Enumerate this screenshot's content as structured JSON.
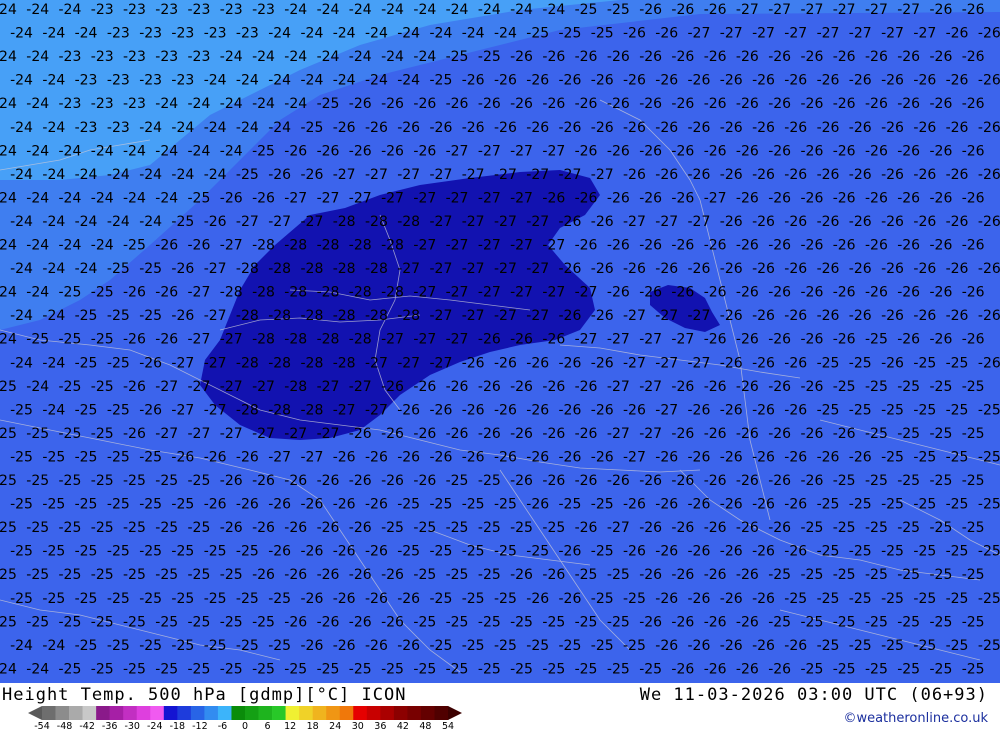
{
  "map": {
    "label_rows": [
      {
        "labels": [
          "24",
          "24",
          "24",
          "23",
          "23",
          "23",
          "23",
          "23",
          "23",
          "24",
          "24",
          "24",
          "24",
          "24",
          "24",
          "24",
          "24",
          "24",
          "25",
          "25",
          "26",
          "26",
          "26",
          "27",
          "27",
          "27",
          "27",
          "27",
          "27",
          "26",
          "26"
        ]
      },
      {
        "labels": [
          "24",
          "24",
          "24",
          "23",
          "23",
          "23",
          "23",
          "23",
          "24",
          "24",
          "24",
          "24",
          "24",
          "24",
          "24",
          "24",
          "25",
          "25",
          "25",
          "26",
          "26",
          "27",
          "27",
          "27",
          "27",
          "27",
          "27",
          "27",
          "27",
          "26",
          "26"
        ]
      },
      {
        "labels": [
          "24",
          "24",
          "23",
          "23",
          "23",
          "23",
          "23",
          "24",
          "24",
          "24",
          "24",
          "24",
          "24",
          "24",
          "25",
          "25",
          "26",
          "26",
          "26",
          "26",
          "26",
          "26",
          "26",
          "26",
          "26",
          "26",
          "26",
          "26",
          "26",
          "26",
          "26"
        ]
      },
      {
        "labels": [
          "24",
          "24",
          "23",
          "23",
          "23",
          "23",
          "24",
          "24",
          "24",
          "24",
          "24",
          "24",
          "24",
          "25",
          "26",
          "26",
          "26",
          "26",
          "26",
          "26",
          "26",
          "26",
          "26",
          "26",
          "26",
          "26",
          "26",
          "26",
          "26",
          "26",
          "26"
        ]
      },
      {
        "labels": [
          "24",
          "24",
          "23",
          "23",
          "23",
          "24",
          "24",
          "24",
          "24",
          "24",
          "25",
          "26",
          "26",
          "26",
          "26",
          "26",
          "26",
          "26",
          "26",
          "26",
          "26",
          "26",
          "26",
          "26",
          "26",
          "26",
          "26",
          "26",
          "26",
          "26",
          "26"
        ]
      },
      {
        "labels": [
          "24",
          "24",
          "23",
          "23",
          "24",
          "24",
          "24",
          "24",
          "24",
          "25",
          "26",
          "26",
          "26",
          "26",
          "26",
          "26",
          "26",
          "26",
          "26",
          "26",
          "26",
          "26",
          "26",
          "26",
          "26",
          "26",
          "26",
          "26",
          "26",
          "26",
          "26"
        ]
      },
      {
        "labels": [
          "24",
          "24",
          "24",
          "24",
          "24",
          "24",
          "24",
          "24",
          "25",
          "26",
          "26",
          "26",
          "26",
          "26",
          "27",
          "27",
          "27",
          "27",
          "26",
          "26",
          "26",
          "26",
          "26",
          "26",
          "26",
          "26",
          "26",
          "26",
          "26",
          "26",
          "26"
        ]
      },
      {
        "labels": [
          "24",
          "24",
          "24",
          "24",
          "24",
          "24",
          "24",
          "25",
          "26",
          "26",
          "27",
          "27",
          "27",
          "27",
          "27",
          "27",
          "27",
          "27",
          "27",
          "26",
          "26",
          "26",
          "26",
          "26",
          "26",
          "26",
          "26",
          "26",
          "26",
          "26",
          "26"
        ]
      },
      {
        "labels": [
          "24",
          "24",
          "24",
          "24",
          "24",
          "24",
          "25",
          "26",
          "26",
          "27",
          "27",
          "27",
          "27",
          "27",
          "27",
          "27",
          "27",
          "26",
          "26",
          "26",
          "26",
          "26",
          "27",
          "26",
          "26",
          "26",
          "26",
          "26",
          "26",
          "26",
          "26"
        ]
      },
      {
        "labels": [
          "24",
          "24",
          "24",
          "24",
          "24",
          "25",
          "26",
          "27",
          "27",
          "27",
          "28",
          "28",
          "28",
          "27",
          "27",
          "27",
          "27",
          "26",
          "26",
          "27",
          "27",
          "27",
          "26",
          "26",
          "26",
          "26",
          "26",
          "26",
          "26",
          "26",
          "26"
        ]
      },
      {
        "labels": [
          "24",
          "24",
          "24",
          "24",
          "25",
          "26",
          "26",
          "27",
          "28",
          "28",
          "28",
          "28",
          "28",
          "27",
          "27",
          "27",
          "27",
          "27",
          "26",
          "26",
          "26",
          "26",
          "26",
          "26",
          "26",
          "26",
          "26",
          "26",
          "26",
          "26",
          "26"
        ]
      },
      {
        "labels": [
          "24",
          "24",
          "24",
          "25",
          "25",
          "26",
          "27",
          "28",
          "28",
          "28",
          "28",
          "28",
          "27",
          "27",
          "27",
          "27",
          "27",
          "26",
          "26",
          "26",
          "26",
          "26",
          "26",
          "26",
          "26",
          "26",
          "26",
          "26",
          "26",
          "26",
          "26"
        ]
      },
      {
        "labels": [
          "24",
          "24",
          "25",
          "25",
          "26",
          "26",
          "27",
          "28",
          "28",
          "28",
          "28",
          "28",
          "28",
          "27",
          "27",
          "27",
          "27",
          "27",
          "27",
          "26",
          "26",
          "26",
          "26",
          "26",
          "26",
          "26",
          "26",
          "26",
          "26",
          "26",
          "26"
        ]
      },
      {
        "labels": [
          "24",
          "24",
          "25",
          "25",
          "25",
          "26",
          "27",
          "28",
          "28",
          "28",
          "28",
          "28",
          "28",
          "27",
          "27",
          "27",
          "27",
          "26",
          "26",
          "27",
          "27",
          "27",
          "26",
          "26",
          "26",
          "26",
          "26",
          "26",
          "26",
          "26",
          "26"
        ]
      },
      {
        "labels": [
          "24",
          "25",
          "25",
          "25",
          "26",
          "26",
          "27",
          "27",
          "28",
          "28",
          "28",
          "28",
          "27",
          "27",
          "27",
          "26",
          "26",
          "26",
          "27",
          "27",
          "27",
          "27",
          "26",
          "26",
          "26",
          "26",
          "26",
          "25",
          "26",
          "26",
          "26"
        ]
      },
      {
        "labels": [
          "24",
          "24",
          "25",
          "25",
          "26",
          "27",
          "27",
          "28",
          "28",
          "28",
          "28",
          "27",
          "27",
          "27",
          "26",
          "26",
          "26",
          "26",
          "26",
          "27",
          "27",
          "27",
          "26",
          "26",
          "26",
          "25",
          "25",
          "26",
          "25",
          "25",
          "26"
        ]
      },
      {
        "labels": [
          "25",
          "24",
          "25",
          "25",
          "26",
          "27",
          "27",
          "27",
          "27",
          "28",
          "27",
          "27",
          "26",
          "26",
          "26",
          "26",
          "26",
          "26",
          "26",
          "27",
          "27",
          "26",
          "26",
          "26",
          "26",
          "26",
          "25",
          "25",
          "25",
          "25",
          "25"
        ]
      },
      {
        "labels": [
          "25",
          "24",
          "25",
          "25",
          "26",
          "27",
          "27",
          "28",
          "28",
          "28",
          "27",
          "27",
          "26",
          "26",
          "26",
          "26",
          "26",
          "26",
          "26",
          "26",
          "27",
          "26",
          "26",
          "26",
          "26",
          "25",
          "25",
          "25",
          "25",
          "25",
          "25"
        ]
      },
      {
        "labels": [
          "25",
          "25",
          "25",
          "25",
          "26",
          "27",
          "27",
          "27",
          "27",
          "27",
          "27",
          "26",
          "26",
          "26",
          "26",
          "26",
          "26",
          "26",
          "26",
          "27",
          "27",
          "26",
          "26",
          "26",
          "26",
          "26",
          "26",
          "25",
          "25",
          "25",
          "25"
        ]
      },
      {
        "labels": [
          "25",
          "25",
          "25",
          "25",
          "25",
          "26",
          "26",
          "26",
          "27",
          "27",
          "26",
          "26",
          "26",
          "26",
          "26",
          "26",
          "26",
          "26",
          "26",
          "27",
          "26",
          "26",
          "26",
          "26",
          "26",
          "26",
          "26",
          "25",
          "25",
          "25",
          "25"
        ]
      },
      {
        "labels": [
          "25",
          "25",
          "25",
          "25",
          "25",
          "25",
          "25",
          "26",
          "26",
          "26",
          "26",
          "26",
          "26",
          "26",
          "25",
          "25",
          "26",
          "26",
          "26",
          "26",
          "26",
          "26",
          "26",
          "26",
          "26",
          "26",
          "25",
          "25",
          "25",
          "25",
          "25"
        ]
      },
      {
        "labels": [
          "25",
          "25",
          "25",
          "25",
          "25",
          "25",
          "26",
          "26",
          "26",
          "26",
          "26",
          "26",
          "25",
          "25",
          "25",
          "25",
          "26",
          "25",
          "25",
          "26",
          "26",
          "26",
          "26",
          "26",
          "26",
          "25",
          "25",
          "25",
          "25",
          "25",
          "25"
        ]
      },
      {
        "labels": [
          "25",
          "25",
          "25",
          "25",
          "25",
          "25",
          "25",
          "26",
          "26",
          "26",
          "26",
          "26",
          "25",
          "25",
          "25",
          "25",
          "25",
          "25",
          "26",
          "27",
          "26",
          "26",
          "26",
          "26",
          "26",
          "25",
          "25",
          "25",
          "25",
          "25",
          "25"
        ]
      },
      {
        "labels": [
          "25",
          "25",
          "25",
          "25",
          "25",
          "25",
          "25",
          "25",
          "26",
          "26",
          "26",
          "26",
          "25",
          "25",
          "25",
          "25",
          "25",
          "26",
          "25",
          "26",
          "26",
          "26",
          "26",
          "26",
          "26",
          "25",
          "25",
          "25",
          "25",
          "25",
          "25"
        ]
      },
      {
        "labels": [
          "25",
          "25",
          "25",
          "25",
          "25",
          "25",
          "25",
          "25",
          "26",
          "26",
          "26",
          "26",
          "26",
          "25",
          "25",
          "25",
          "26",
          "26",
          "25",
          "25",
          "26",
          "26",
          "26",
          "26",
          "25",
          "25",
          "25",
          "25",
          "25",
          "25",
          "25"
        ]
      },
      {
        "labels": [
          "25",
          "25",
          "25",
          "25",
          "25",
          "25",
          "25",
          "25",
          "25",
          "26",
          "26",
          "26",
          "26",
          "25",
          "25",
          "25",
          "26",
          "26",
          "25",
          "25",
          "26",
          "26",
          "26",
          "26",
          "25",
          "25",
          "25",
          "25",
          "25",
          "25",
          "25"
        ]
      },
      {
        "labels": [
          "25",
          "25",
          "25",
          "25",
          "25",
          "25",
          "25",
          "25",
          "25",
          "26",
          "26",
          "26",
          "26",
          "25",
          "25",
          "25",
          "25",
          "25",
          "25",
          "25",
          "26",
          "26",
          "26",
          "26",
          "25",
          "25",
          "25",
          "25",
          "25",
          "25",
          "25"
        ]
      },
      {
        "labels": [
          "24",
          "24",
          "25",
          "25",
          "25",
          "25",
          "25",
          "25",
          "25",
          "26",
          "26",
          "26",
          "26",
          "25",
          "25",
          "25",
          "25",
          "25",
          "25",
          "25",
          "26",
          "26",
          "26",
          "26",
          "26",
          "25",
          "25",
          "25",
          "25",
          "25",
          "25"
        ]
      },
      {
        "labels": [
          "24",
          "24",
          "25",
          "25",
          "25",
          "25",
          "25",
          "25",
          "25",
          "25",
          "25",
          "25",
          "25",
          "25",
          "25",
          "25",
          "25",
          "25",
          "25",
          "25",
          "25",
          "26",
          "26",
          "26",
          "26",
          "25",
          "25",
          "25",
          "25",
          "25",
          "25"
        ]
      }
    ]
  },
  "footer": {
    "title_left": "Height Temp. 500 hPa [gdmp][°C] ICON",
    "title_right": "We 11-03-2026 03:00 UTC (06+93)",
    "credit": "©weatheronline.co.uk",
    "scale_colors": [
      "#6e6e6e",
      "#8c8c8c",
      "#aaaaaa",
      "#c8c8c8",
      "#8a1a8a",
      "#a61fa6",
      "#c22fc2",
      "#de3fde",
      "#f05af0",
      "#1414d2",
      "#1e3cdc",
      "#2864e6",
      "#328cf0",
      "#3cb4fa",
      "#0a8c0a",
      "#14a014",
      "#1eb41e",
      "#28c828",
      "#f0f032",
      "#f0d228",
      "#f0b41e",
      "#f09614",
      "#f0780a",
      "#e60000",
      "#c80000",
      "#aa0000",
      "#8c0000",
      "#780000",
      "#640000",
      "#500000"
    ],
    "scale_labels": [
      "-54",
      "-48",
      "-42",
      "-36",
      "-30",
      "-24",
      "-18",
      "-12",
      "-6",
      "0",
      "6",
      "12",
      "18",
      "24",
      "30",
      "36",
      "42",
      "48",
      "54"
    ]
  }
}
